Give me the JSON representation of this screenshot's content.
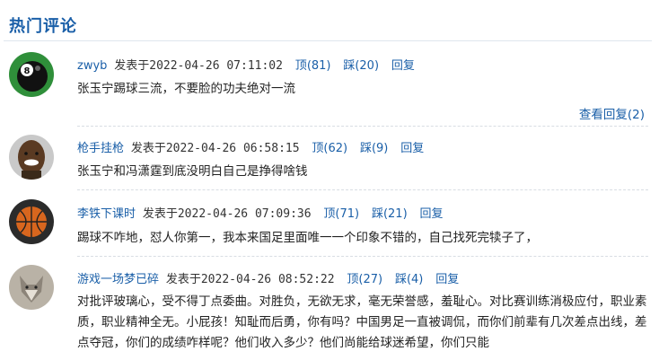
{
  "section_title": "热门评论",
  "labels": {
    "posted_at": "发表于",
    "up": "顶",
    "down": "踩",
    "reply": "回复"
  },
  "comments": [
    {
      "user": "zwyb",
      "time": "2022-04-26 07:11:02",
      "up_count": "(81)",
      "down_count": "(20)",
      "text": "张玉宁踢球三流，不要脸的功夫绝对一流",
      "view_replies": "查看回复(2)",
      "avatar": "billiard-ball-8"
    },
    {
      "user": "枪手挂枪",
      "time": "2022-04-26 06:58:15",
      "up_count": "(62)",
      "down_count": "(9)",
      "text": "张玉宁和冯潇霆到底没明白自己是挣得啥钱",
      "avatar": "smiling-man"
    },
    {
      "user": "李铁下课时",
      "time": "2022-04-26 07:09:36",
      "up_count": "(71)",
      "down_count": "(21)",
      "text": "踢球不咋地，怼人你第一，我本来国足里面唯一一个印象不错的，自己找死完犊子了，",
      "avatar": "basketball"
    },
    {
      "user": "游戏一场梦已碎",
      "time": "2022-04-26 08:52:22",
      "up_count": "(27)",
      "down_count": "(4)",
      "text": "对批评玻璃心，受不得丁点委曲。对胜负，无欲无求，毫无荣誉感，羞耻心。对比赛训练消极应付，职业素质，职业精神全无。小屁孩！知耻而后勇，你有吗？中国男足一直被调侃，而你们前辈有几次差点出线，差点夺冠，你们的成绩咋样呢？他们收入多少？他们尚能给球迷希望，你们只能",
      "avatar": "wolf"
    }
  ]
}
